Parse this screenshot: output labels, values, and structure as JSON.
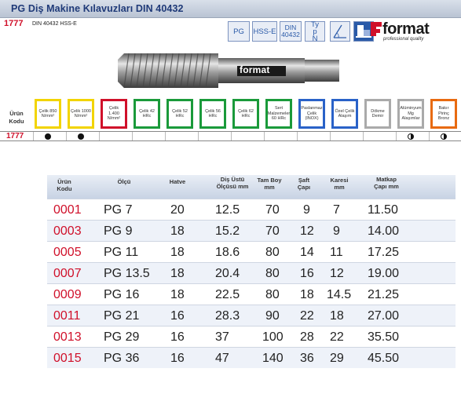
{
  "header": {
    "title": "PG Diş Makine Kılavuzları DIN 40432",
    "code": "1777",
    "norm": "DIN 40432 HSS-E"
  },
  "standards": [
    {
      "label": "PG"
    },
    {
      "label": "HSS-E"
    },
    {
      "label": "DIN 40432"
    },
    {
      "label": "Typ N"
    }
  ],
  "logo": {
    "word": "format",
    "sub": "professional quality"
  },
  "tool_brand": "format",
  "materials": {
    "row_label": "Ürün Kodu",
    "items": [
      {
        "label": "Çelik 850 N/mm²",
        "color": "#f2d400"
      },
      {
        "label": "Çelik 1000 N/mm²",
        "color": "#f2d400"
      },
      {
        "label": "Çelik 1.400 N/mm²",
        "color": "#d0102a"
      },
      {
        "label": "Çelik 42 HRc",
        "color": "#1a9a3a"
      },
      {
        "label": "Çelik 52 HRc",
        "color": "#1a9a3a"
      },
      {
        "label": "Çelik 56 HRc",
        "color": "#1a9a3a"
      },
      {
        "label": "Çelik 62 HRc",
        "color": "#1a9a3a"
      },
      {
        "label": "Sert Malzemeler 60 HRc",
        "color": "#1a9a3a"
      },
      {
        "label": "Paslanmaz Çelik (INOX)",
        "color": "#2a62c8"
      },
      {
        "label": "Özel Çelik Alaşım",
        "color": "#2a62c8"
      },
      {
        "label": "Dökme Demir",
        "color": "#aaaaaa"
      },
      {
        "label": "Alüminyum Mg Alaşımlar",
        "color": "#aaaaaa"
      },
      {
        "label": "Bakır Pirinç Bronz",
        "color": "#e86a10"
      }
    ]
  },
  "application": {
    "code": "1777",
    "marks": [
      "full",
      "full",
      "",
      "",
      "",
      "",
      "",
      "",
      "",
      "",
      "",
      "half",
      "half"
    ]
  },
  "table": {
    "headers": [
      "Ürün Kodu",
      "Ölçü",
      "Hatve",
      "Diş Üstü Ölçüsü mm",
      "Tam Boy mm",
      "Şaft Çapı",
      "Karesi mm",
      "Matkap Çapı mm"
    ],
    "rows": [
      [
        "0001",
        "PG  7",
        "20",
        "12.5",
        "70",
        "9",
        "7",
        "11.50"
      ],
      [
        "0003",
        "PG  9",
        "18",
        "15.2",
        "70",
        "12",
        "9",
        "14.00"
      ],
      [
        "0005",
        "PG 11",
        "18",
        "18.6",
        "80",
        "14",
        "11",
        "17.25"
      ],
      [
        "0007",
        "PG 13.5",
        "18",
        "20.4",
        "80",
        "16",
        "12",
        "19.00"
      ],
      [
        "0009",
        "PG 16",
        "18",
        "22.5",
        "80",
        "18",
        "14.5",
        "21.25"
      ],
      [
        "0011",
        "PG 21",
        "16",
        "28.3",
        "90",
        "22",
        "18",
        "27.00"
      ],
      [
        "0013",
        "PG 29",
        "16",
        "37",
        "100",
        "28",
        "22",
        "35.50"
      ],
      [
        "0015",
        "PG 36",
        "16",
        "47",
        "140",
        "36",
        "29",
        "45.50"
      ]
    ]
  }
}
